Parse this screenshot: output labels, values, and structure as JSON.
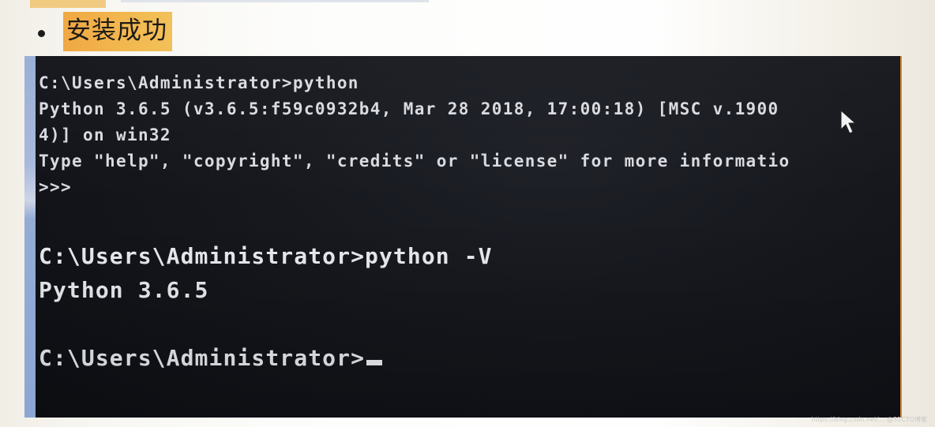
{
  "slide": {
    "bullet_heading": "安装成功",
    "highlight_color": "#f2b64e"
  },
  "terminal": {
    "background_color": "#14161c",
    "text_color": "#e1e3e8",
    "session_1": {
      "lines": [
        "C:\\Users\\Administrator>python",
        "Python 3.6.5 (v3.6.5:f59c0932b4, Mar 28 2018, 17:00:18) [MSC v.1900",
        "4)] on win32",
        "Type \"help\", \"copyright\", \"credits\" or \"license\" for more informatio",
        ">>>"
      ]
    },
    "session_2": {
      "command_line": "C:\\Users\\Administrator>python -V",
      "output_line": "Python 3.6.5",
      "prompt_line": "C:\\Users\\Administrator>"
    }
  },
  "watermark": "https://blog.csdn.net/... @51CTO博客"
}
